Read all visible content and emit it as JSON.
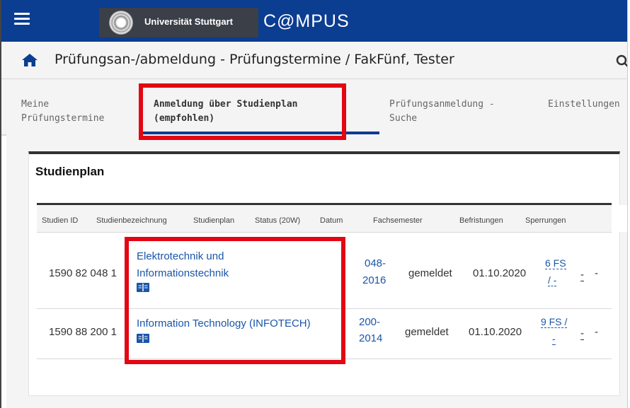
{
  "header": {
    "menu_icon": "hamburger-icon",
    "university_name": "Universität Stuttgart",
    "brand": "C@MPUS"
  },
  "titlebar": {
    "home_icon": "home-icon",
    "title": "Prüfungsan-/abmeldung - Prüfungstermine / FakFünf, Tester",
    "search_icon": "search-icon"
  },
  "tabs": [
    {
      "label": "Meine\nPrüfungstermine",
      "active": false
    },
    {
      "label": "Anmeldung über Studienplan\n(empfohlen)",
      "active": true
    },
    {
      "label": "Prüfungsanmeldung -\nSuche",
      "active": false
    },
    {
      "label": "Einstellungen",
      "active": false
    }
  ],
  "panel": {
    "title": "Studienplan",
    "columns": [
      "Studien ID",
      "Studienbezeichnung",
      "Studienplan",
      "Status (20W)",
      "Datum",
      "Fachsemester",
      "Befristungen",
      "Sperrungen"
    ],
    "rows": [
      {
        "studien_id": "1590 82 048 1",
        "bezeichnung_line1": "Elektrotechnik und",
        "bezeichnung_line2": "Informationstechnik",
        "plan_line1": "048-",
        "plan_line2": "2016",
        "status": "gemeldet",
        "datum": "01.10.2020",
        "fachsemester_line1": "6 FS",
        "fachsemester_line2": "/ -",
        "befristungen": "-",
        "sperrungen": "-"
      },
      {
        "studien_id": "1590 88 200 1",
        "bezeichnung_line1": "Information Technology (INFOTECH)",
        "bezeichnung_line2": "",
        "plan_line1": "200-",
        "plan_line2": "2014",
        "status": "gemeldet",
        "datum": "01.10.2020",
        "fachsemester_line1": "9 FS /",
        "fachsemester_line2": "-",
        "befristungen": "-",
        "sperrungen": "-"
      }
    ]
  },
  "colors": {
    "topbar": "#0b3d91",
    "highlight": "#e30613",
    "link": "#1a56a8"
  }
}
